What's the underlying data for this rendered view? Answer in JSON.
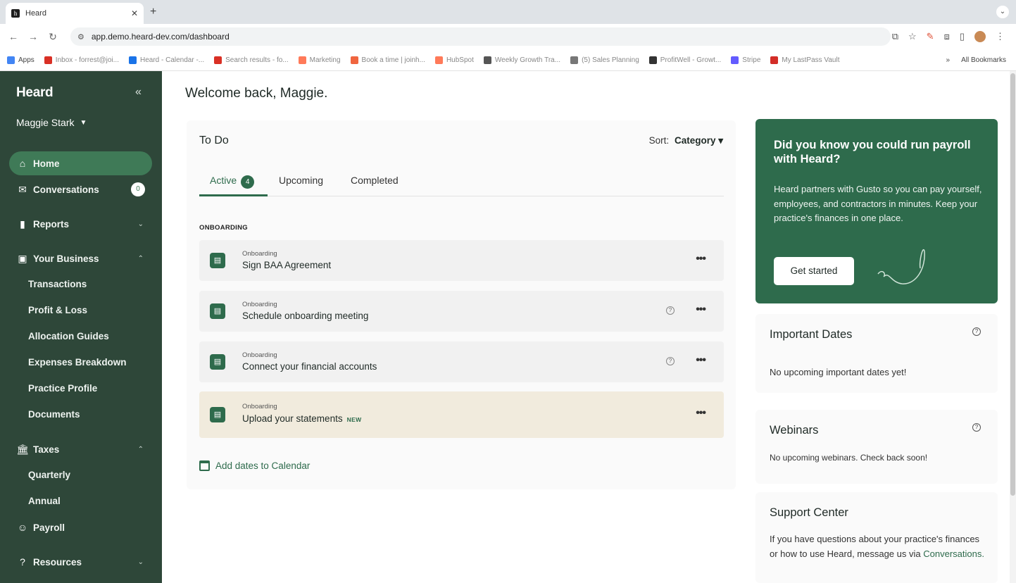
{
  "browser": {
    "tab_title": "Heard",
    "favicon_letter": "h",
    "url": "app.demo.heard-dev.com/dashboard",
    "bookmarks": [
      {
        "label": "Apps",
        "color": "#4285f4"
      },
      {
        "label": "Inbox - forrest@joi...",
        "color": "#d93025"
      },
      {
        "label": "Heard - Calendar -...",
        "color": "#1a73e8"
      },
      {
        "label": "Search results - fo...",
        "color": "#d93025"
      },
      {
        "label": "Marketing",
        "color": "#ff7a59"
      },
      {
        "label": "Book a time | joinh...",
        "color": "#f0653f"
      },
      {
        "label": "HubSpot",
        "color": "#ff7a59"
      },
      {
        "label": "Weekly Growth Tra...",
        "color": "#555555"
      },
      {
        "label": "(5) Sales Planning",
        "color": "#777777"
      },
      {
        "label": "ProfitWell - Growt...",
        "color": "#333333"
      },
      {
        "label": "Stripe",
        "color": "#635bff"
      },
      {
        "label": "My LastPass Vault",
        "color": "#d32d27"
      }
    ],
    "more_bookmarks": "»",
    "all_bookmarks": "All Bookmarks"
  },
  "sidebar": {
    "brand": "Heard",
    "collapse": "«",
    "user_name": "Maggie Stark",
    "items": [
      {
        "label": "Home",
        "icon": "⌂"
      },
      {
        "label": "Conversations",
        "icon": "✉",
        "count": "0"
      },
      {
        "label": "Reports",
        "icon": "▮",
        "chevron": "⌄"
      },
      {
        "label": "Your Business",
        "icon": "▣",
        "chevron": "⌃"
      },
      {
        "label": "Taxes",
        "icon": "⌂",
        "chevron": "⌃"
      },
      {
        "label": "Payroll",
        "icon": "☺"
      },
      {
        "label": "Resources",
        "icon": "?",
        "chevron": "⌄"
      }
    ],
    "business_sub": [
      "Transactions",
      "Profit & Loss",
      "Allocation Guides",
      "Expenses Breakdown",
      "Practice Profile",
      "Documents"
    ],
    "taxes_sub": [
      "Quarterly",
      "Annual"
    ]
  },
  "main": {
    "welcome": "Welcome back, Maggie.",
    "todo": {
      "title": "To Do",
      "sort_label": "Sort:",
      "sort_value": "Category ▾",
      "tabs": [
        {
          "label": "Active",
          "badge": "4"
        },
        {
          "label": "Upcoming"
        },
        {
          "label": "Completed"
        }
      ],
      "section": "ONBOARDING",
      "tasks": [
        {
          "category": "Onboarding",
          "name": "Sign BAA Agreement"
        },
        {
          "category": "Onboarding",
          "name": "Schedule onboarding meeting"
        },
        {
          "category": "Onboarding",
          "name": "Connect your financial accounts"
        },
        {
          "category": "Onboarding",
          "name": "Upload your statements",
          "tag": "NEW"
        }
      ],
      "add_calendar": "Add dates to Calendar"
    },
    "promo": {
      "title": "Did you know you could run payroll with Heard?",
      "body": "Heard partners with Gusto so you can pay yourself, employees, and contractors in minutes. Keep your practice's finances in one place.",
      "button": "Get started"
    },
    "important_dates": {
      "title": "Important Dates",
      "body": "No upcoming important dates yet!"
    },
    "webinars": {
      "title": "Webinars",
      "body": "No upcoming webinars. Check back soon!"
    },
    "support": {
      "title": "Support Center",
      "body": "If you have questions about your practice's finances or how to use Heard, message us via",
      "link": "Conversations."
    }
  }
}
